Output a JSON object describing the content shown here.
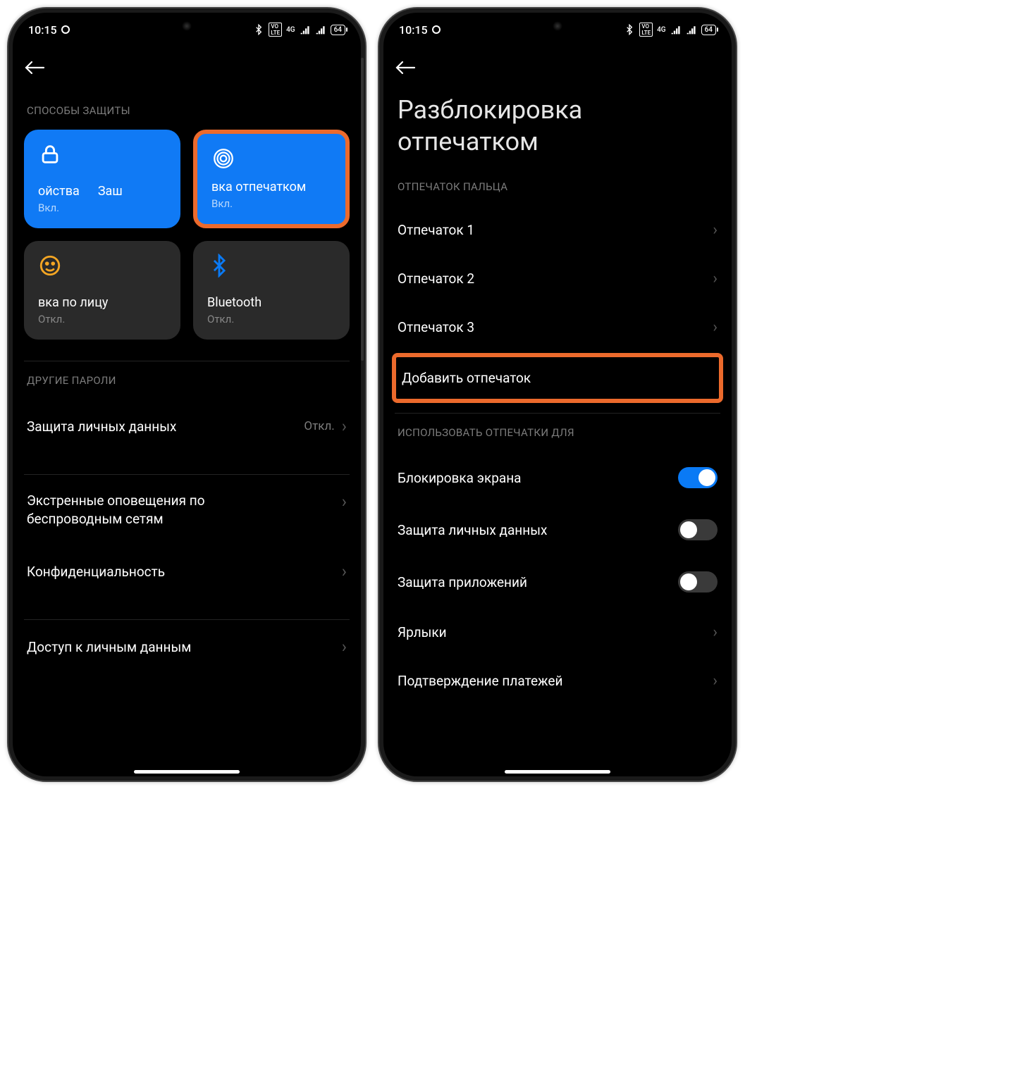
{
  "statusbar": {
    "time": "10:15",
    "battery": "64"
  },
  "left_screen": {
    "section_methods": "СПОСОБЫ ЗАЩИТЫ",
    "tiles": {
      "lock": {
        "title_a": "ойства",
        "title_b": "Заш",
        "status": "Вкл."
      },
      "finger": {
        "title": "вка отпечатком",
        "status": "Вкл."
      },
      "face": {
        "title": "вка по лицу",
        "status": "Откл."
      },
      "bt": {
        "title": "Bluetooth",
        "status": "Откл."
      }
    },
    "section_other": "ДРУГИЕ ПАРОЛИ",
    "rows": {
      "privacy": {
        "label": "Защита личных данных",
        "meta": "Откл."
      },
      "emergency": {
        "label": "Экстренные оповещения по беспроводным сетям"
      },
      "conf": {
        "label": "Конфиденциальность"
      },
      "access": {
        "label": "Доступ к личным данным"
      }
    }
  },
  "right_screen": {
    "title": "Разблокировка отпечатком",
    "section_finger": "ОТПЕЧАТОК ПАЛЬЦА",
    "prints": [
      "Отпечаток 1",
      "Отпечаток 2",
      "Отпечаток 3"
    ],
    "add": "Добавить отпечаток",
    "section_use": "ИСПОЛЬЗОВАТЬ ОТПЕЧАТКИ ДЛЯ",
    "toggles": {
      "lockscreen": {
        "label": "Блокировка экрана",
        "on": true
      },
      "private": {
        "label": "Защита личных данных",
        "on": false
      },
      "apps": {
        "label": "Защита приложений",
        "on": false
      }
    },
    "shortcuts": "Ярлыки",
    "payment": "Подтверждение платежей"
  }
}
